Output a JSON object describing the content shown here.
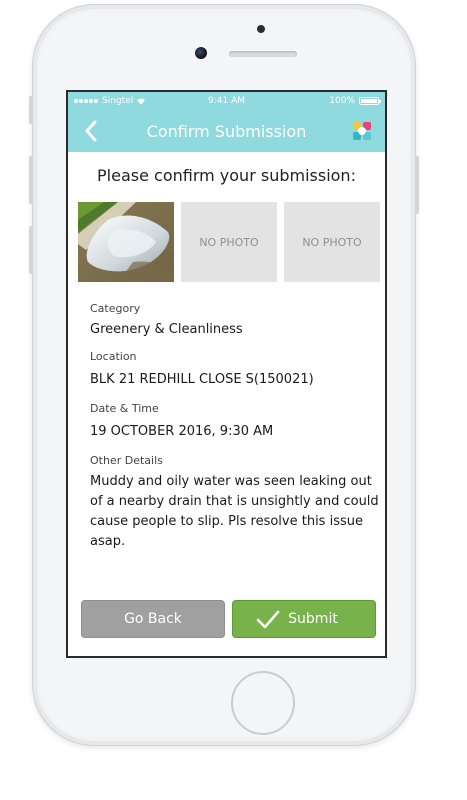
{
  "status_bar": {
    "carrier": "Singtel",
    "time": "9:41 AM",
    "battery": "100%",
    "battery_level": 1.0
  },
  "nav": {
    "title": "Confirm Submission",
    "back_icon": "chevron-left-icon",
    "logo_icon": "app-logo-icon"
  },
  "heading": "Please confirm your submission:",
  "photos": {
    "slot2": "NO PHOTO",
    "slot3": "NO PHOTO"
  },
  "details": {
    "category_label": "Category",
    "category_value": "Greenery & Cleanliness",
    "location_label": "Location",
    "location_value": "BLK 21 REDHILL CLOSE S(150021)",
    "datetime_label": "Date & Time",
    "datetime_value": "19 OCTOBER 2016, 9:30 AM",
    "other_label": "Other Details",
    "other_value": "Muddy and oily water was seen leaking out of a nearby drain that is unsightly and could cause people to slip. Pls resolve this issue asap."
  },
  "buttons": {
    "back": "Go Back",
    "submit": "Submit"
  },
  "colors": {
    "header": "#8fdadf",
    "submit": "#77b34a",
    "back": "#a0a0a0"
  }
}
